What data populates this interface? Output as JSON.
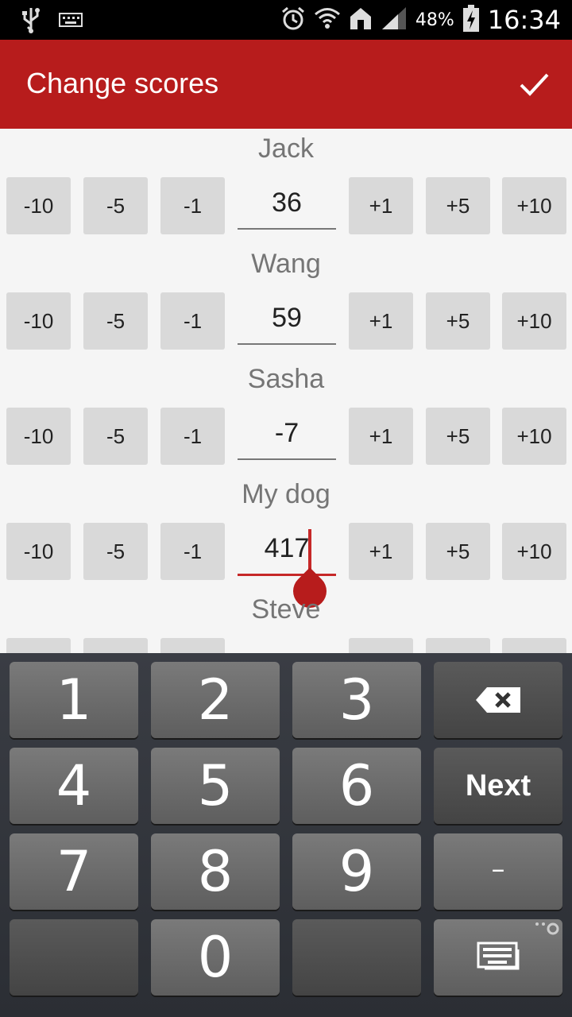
{
  "status_bar": {
    "battery_percent": "48%",
    "time": "16:34",
    "icons": [
      "usb-icon",
      "keyboard-icon",
      "alarm-icon",
      "wifi-icon",
      "home-icon",
      "signal-icon",
      "battery-icon"
    ]
  },
  "app_bar": {
    "title": "Change scores",
    "confirm_icon": "check-icon"
  },
  "adjust_buttons": {
    "minus10": "-10",
    "minus5": "-5",
    "minus1": "-1",
    "plus1": "+1",
    "plus5": "+5",
    "plus10": "+10"
  },
  "players": [
    {
      "name": "Jack",
      "score": "36"
    },
    {
      "name": "Wang",
      "score": "59"
    },
    {
      "name": "Sasha",
      "score": "-7"
    },
    {
      "name": "My dog",
      "score": "417"
    },
    {
      "name": "Steve",
      "score": ""
    }
  ],
  "keyboard": {
    "keys": [
      "1",
      "2",
      "3",
      "4",
      "5",
      "6",
      "7",
      "8",
      "9",
      "0"
    ],
    "next_label": "Next",
    "minus_label": "–",
    "icons": [
      "backspace-icon",
      "keyboard-settings-icon"
    ]
  },
  "colors": {
    "accent": "#b71c1c",
    "button_bg": "#d9d9d9",
    "keyboard_bg": "#2b2e34"
  }
}
